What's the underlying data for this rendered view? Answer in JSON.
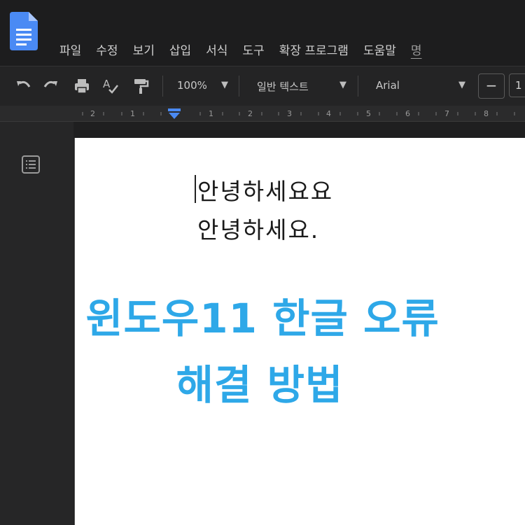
{
  "app": {
    "name": "Google Docs"
  },
  "menu": {
    "items": [
      "파일",
      "수정",
      "보기",
      "삽입",
      "서식",
      "도구",
      "확장 프로그램",
      "도움말"
    ],
    "partial_item": "명"
  },
  "toolbar": {
    "zoom": "100%",
    "style": "일반 텍스트",
    "font": "Arial",
    "font_size_minus": "−",
    "font_size_value": "1"
  },
  "ruler": {
    "labels": [
      "2",
      "1",
      "1",
      "2",
      "3",
      "4",
      "5",
      "6",
      "7",
      "8"
    ]
  },
  "document": {
    "line1": "안녕하세요요",
    "line2": "안녕하세요."
  },
  "headline": {
    "line1": "윈도우11 한글 오류",
    "line2": "해결 방법"
  },
  "colors": {
    "headline": "#2ea8e8",
    "accent_marker": "#4a8af4"
  }
}
